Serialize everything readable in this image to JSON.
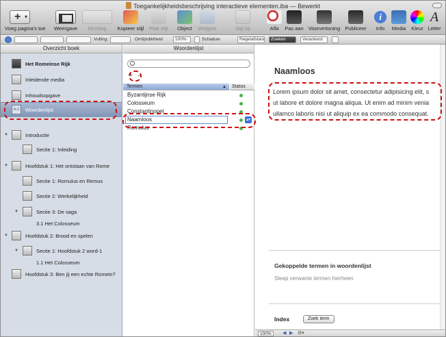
{
  "window": {
    "title": "Toegankelijkheidsbeschrijving interactieve elementen.iba — Bewerkt"
  },
  "toolbar": {
    "add_page": "Voeg pagina's toe",
    "view": "Weergave",
    "zoom_segment": "Dichting",
    "copy_style": "Kopieer stijl",
    "paste_style": "Plak stijl",
    "object": "Object",
    "widgets": "Widgets",
    "stack": "Stijl bij",
    "alpha": "Alfa",
    "fit": "Pas aan",
    "preview": "Voorvertoning",
    "publish": "Publiceer",
    "info": "Info",
    "media": "Media",
    "color": "Kleur",
    "font": "Letter"
  },
  "formatbar": {
    "fill_label": "Vulling:",
    "border_label": "Omlijndiktheid",
    "zoom_value": "100%",
    "shadow_label": "Schaduw",
    "btn_line_spacing": "Regelafstanden",
    "btn_active": "Zoeken",
    "btn_inactive": "Verankerd"
  },
  "sidebar": {
    "header": "Overzicht boek",
    "book_title": "Het Romeinse Rijk",
    "intro_media": "Inleidende media",
    "toc": "Inhoudsopgave",
    "glossary": "Woordenlijst",
    "glossary_thumb": "A-Z",
    "chapters": [
      {
        "label": "Introductie"
      },
      {
        "label": "Sectie 1: Inleiding"
      },
      {
        "label": "Hoofdstuk 1: Het ontstaan van Rome"
      },
      {
        "label": "Sectie 1: Romulus en Remus"
      },
      {
        "label": "Sectie 2: Werkelijkheid"
      },
      {
        "label": "Sectie 3: De saga"
      },
      {
        "label": "3.1 Het Colosseum"
      },
      {
        "label": "Hoofdstuk 2: Brood en spelen"
      },
      {
        "label": "Sectie 1: Hoofdstuk 2 word-1"
      },
      {
        "label": "1.1 Het Colosseum"
      },
      {
        "label": "Hoofdstuk 3: Ben jij een echte Romein?"
      }
    ]
  },
  "glossary": {
    "header": "Woordenlijst",
    "search_placeholder": "",
    "add": "+",
    "remove": "–",
    "col_terms": "Termen",
    "col_status": "Status",
    "terms": [
      {
        "name": "Byzantijnse Rijk"
      },
      {
        "name": "Colosseum"
      },
      {
        "name": "Constantinopel"
      },
      {
        "name": "Naamloos"
      },
      {
        "name": "Romulus"
      }
    ]
  },
  "detail": {
    "term_name": "Naamloos",
    "lorem_lines": [
      "Lorem ipsum dolor sit amet, consectetur adipisicing elit, s",
      "ut labore et dolore magna aliqua. Ut enim ad minim venia",
      "ullamco laboris nisi ut aliquip ex ea commodo consequat."
    ],
    "linked_title": "Gekoppelde termen in woordenlijst",
    "linked_hint": "Sleep verwante termen hierheen",
    "index_label": "Index",
    "index_button": "Zoek term"
  },
  "statusbar": {
    "zoom": "100%"
  },
  "colors": {
    "callout": "#cc1010",
    "selection": "#8195b6",
    "status_dot": "#4cb34c"
  }
}
